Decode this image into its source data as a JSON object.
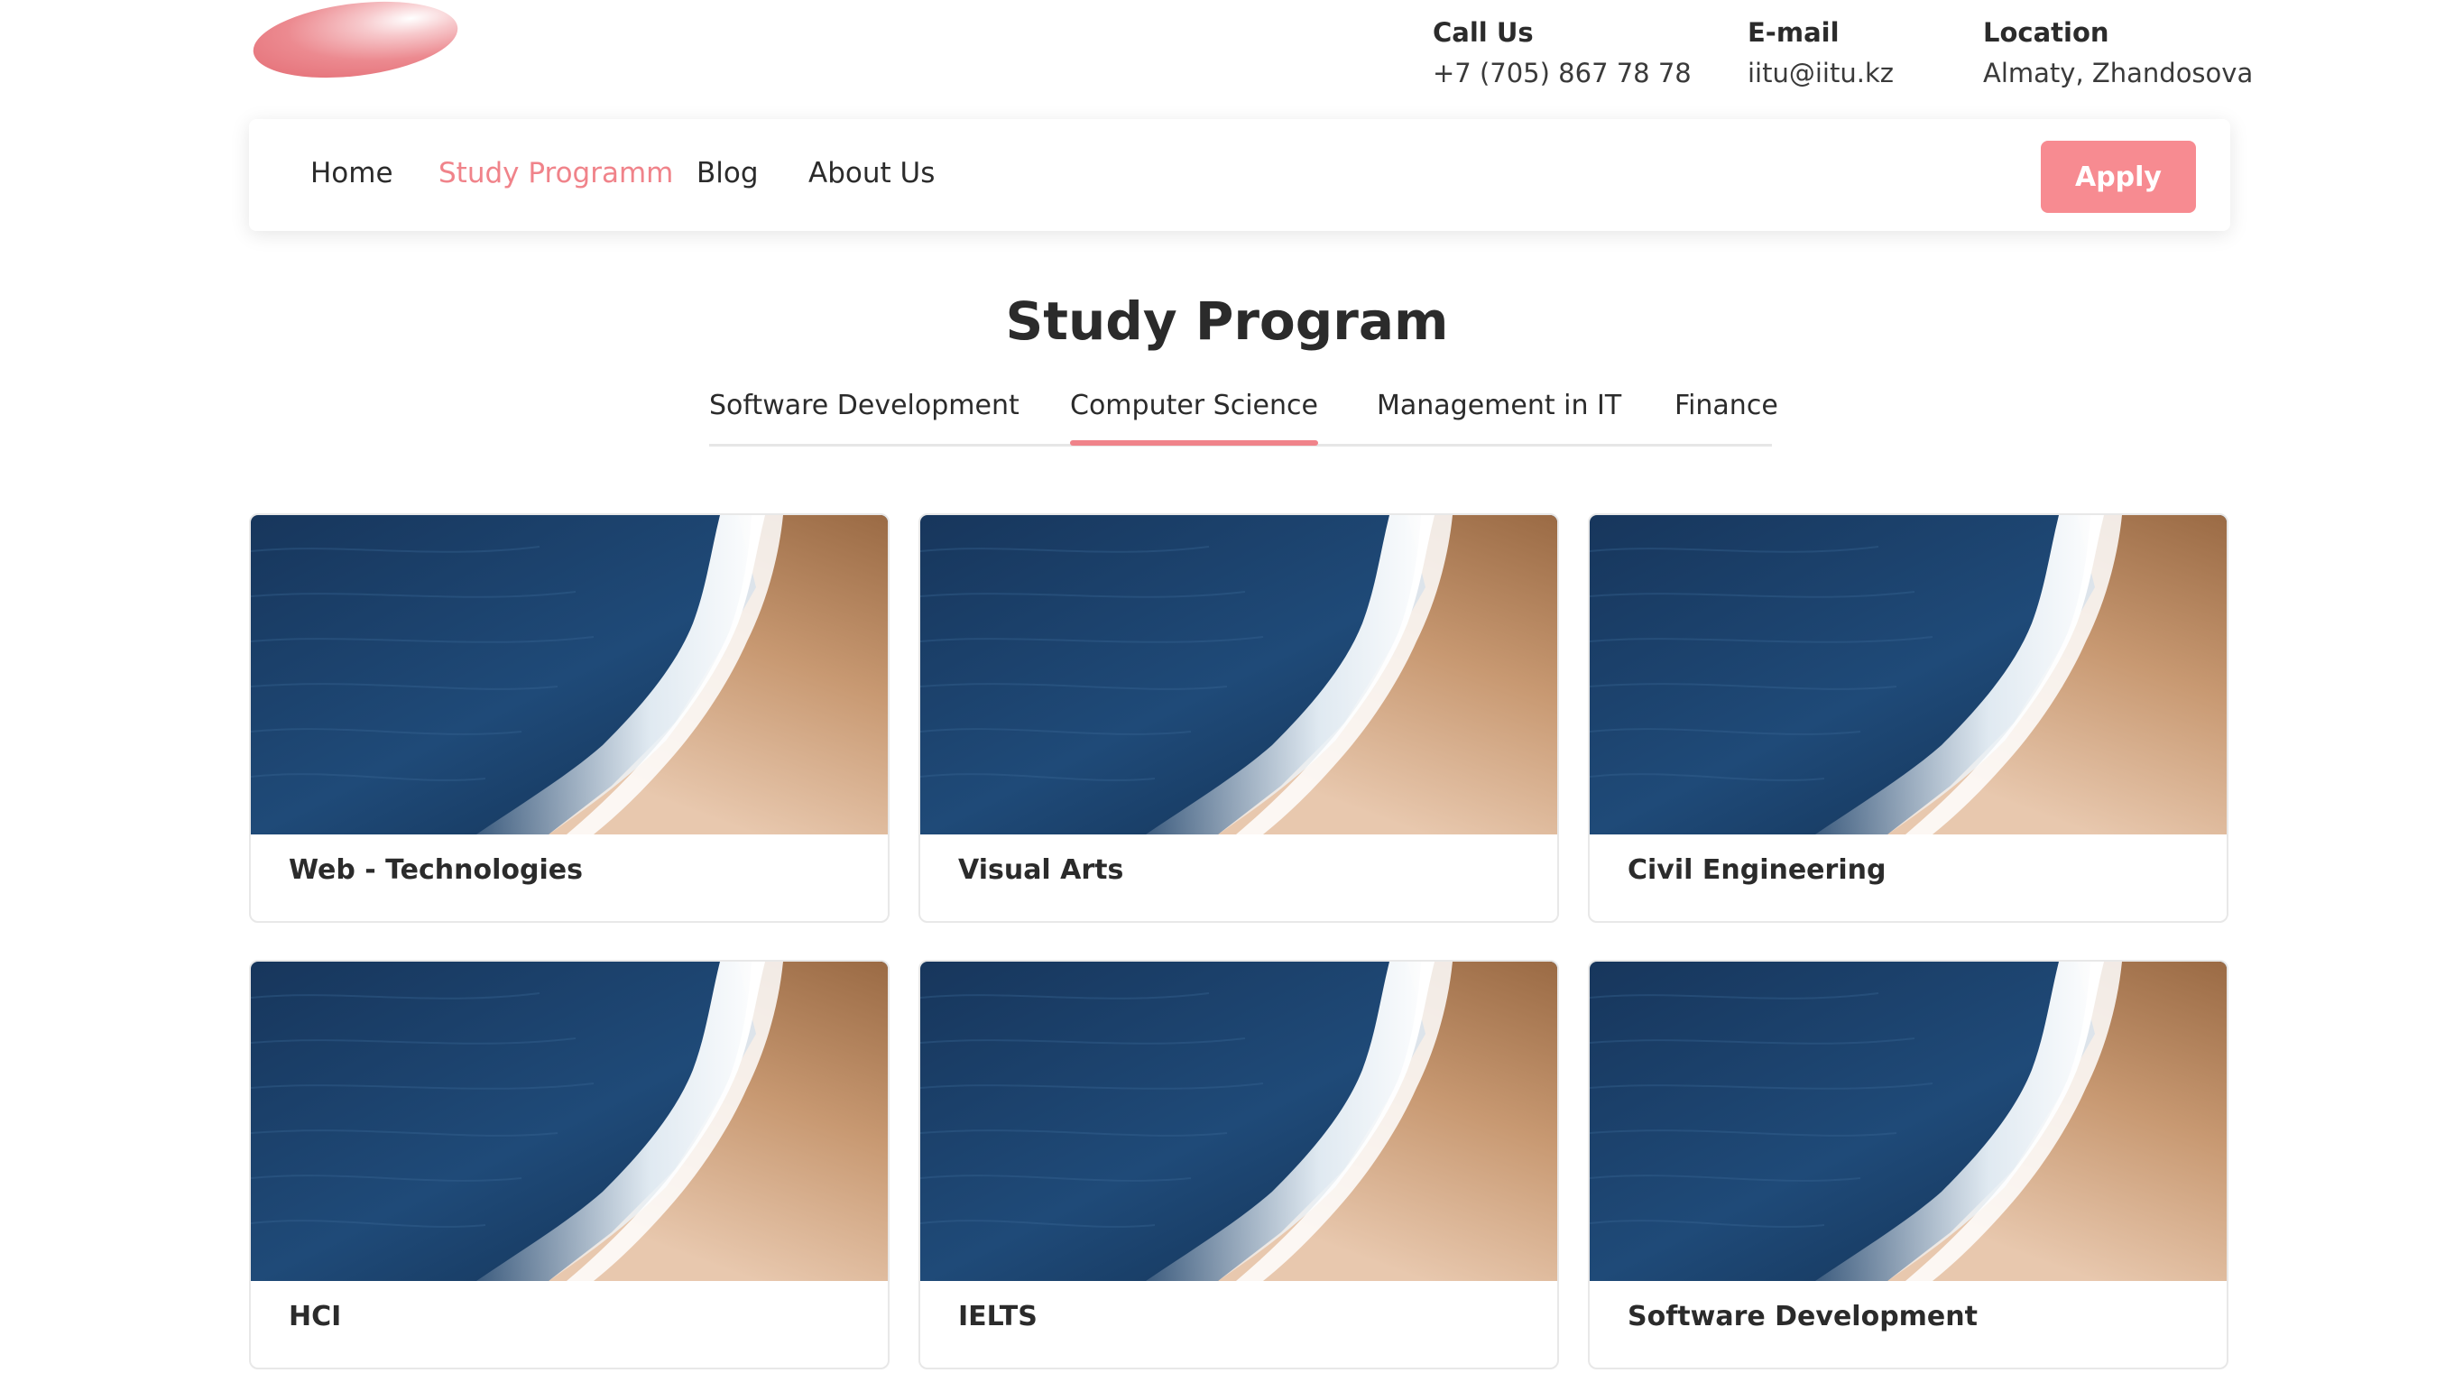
{
  "brand_colors": {
    "accent": "#f78b91",
    "accent_text": "#f0838a",
    "text": "#2b2b2b"
  },
  "header": {
    "logo_icon": "pink-ellipse-logo",
    "contacts": [
      {
        "heading": "Call Us",
        "value": "+7 (705) 867 78 78"
      },
      {
        "heading": "E-mail",
        "value": "iitu@iitu.kz"
      },
      {
        "heading": "Location",
        "value": "Almaty, Zhandosova"
      }
    ]
  },
  "nav": {
    "items": [
      {
        "label": "Home",
        "active": false
      },
      {
        "label": "Study Programm",
        "active": true
      },
      {
        "label": "Blog",
        "active": false
      },
      {
        "label": "About Us",
        "active": false
      }
    ],
    "apply_label": "Apply"
  },
  "main": {
    "title": "Study Program",
    "tabs": [
      {
        "label": "Software Development",
        "active": false
      },
      {
        "label": "Computer Science",
        "active": true
      },
      {
        "label": "Management in IT",
        "active": false
      },
      {
        "label": "Finance",
        "active": false
      }
    ],
    "cards": [
      {
        "label": "Web - Technologies",
        "image": "ocean-beach-aerial-photo"
      },
      {
        "label": "Visual Arts",
        "image": "ocean-beach-aerial-photo"
      },
      {
        "label": "Civil Engineering",
        "image": "ocean-beach-aerial-photo"
      },
      {
        "label": "HCI",
        "image": "ocean-beach-aerial-photo"
      },
      {
        "label": "IELTS",
        "image": "ocean-beach-aerial-photo"
      },
      {
        "label": "Software Development",
        "image": "ocean-beach-aerial-photo"
      }
    ]
  }
}
